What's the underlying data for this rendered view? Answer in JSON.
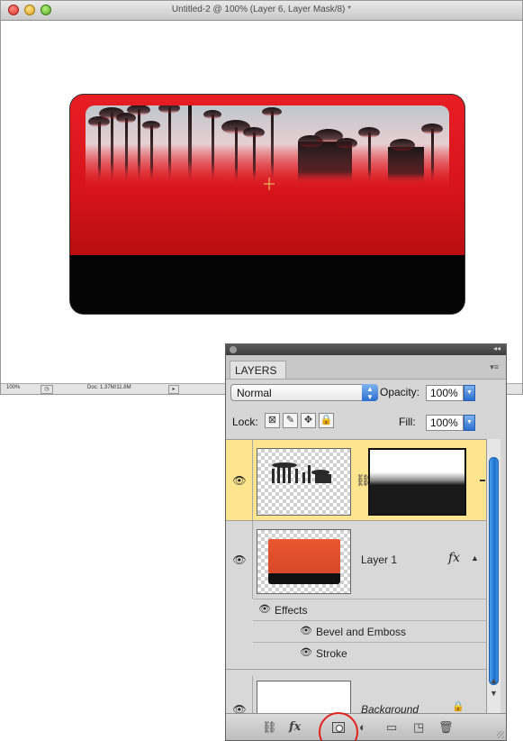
{
  "document": {
    "title": "Untitled-2 @ 100% (Layer 6, Layer Mask/8) *",
    "status_zoom": "100%",
    "status_doc": "Doc: 1.37M/11.8M"
  },
  "layers_panel": {
    "tab_label": "LAYERS",
    "blend_mode": "Normal",
    "opacity_label": "Opacity:",
    "opacity_value": "100%",
    "lock_label": "Lock:",
    "fill_label": "Fill:",
    "fill_value": "100%",
    "layers": [
      {
        "name": "",
        "selected": true,
        "has_mask": true
      },
      {
        "name": "Layer 1",
        "selected": false,
        "has_fx": true,
        "fx_label": "fx",
        "effects_label": "Effects",
        "effects": [
          "Bevel and Emboss",
          "Stroke"
        ]
      },
      {
        "name": "Background",
        "selected": false,
        "locked": true
      }
    ]
  },
  "colors": {
    "card_red": "#e81d24",
    "selection_yellow": "#fde58f",
    "scroll_blue": "#2c7be0",
    "highlight_circle": "#e0221c"
  },
  "icons": [
    "link-layers-icon",
    "fx-icon",
    "add-mask-icon",
    "adjustment-icon",
    "new-group-icon",
    "new-layer-icon",
    "trash-icon"
  ]
}
